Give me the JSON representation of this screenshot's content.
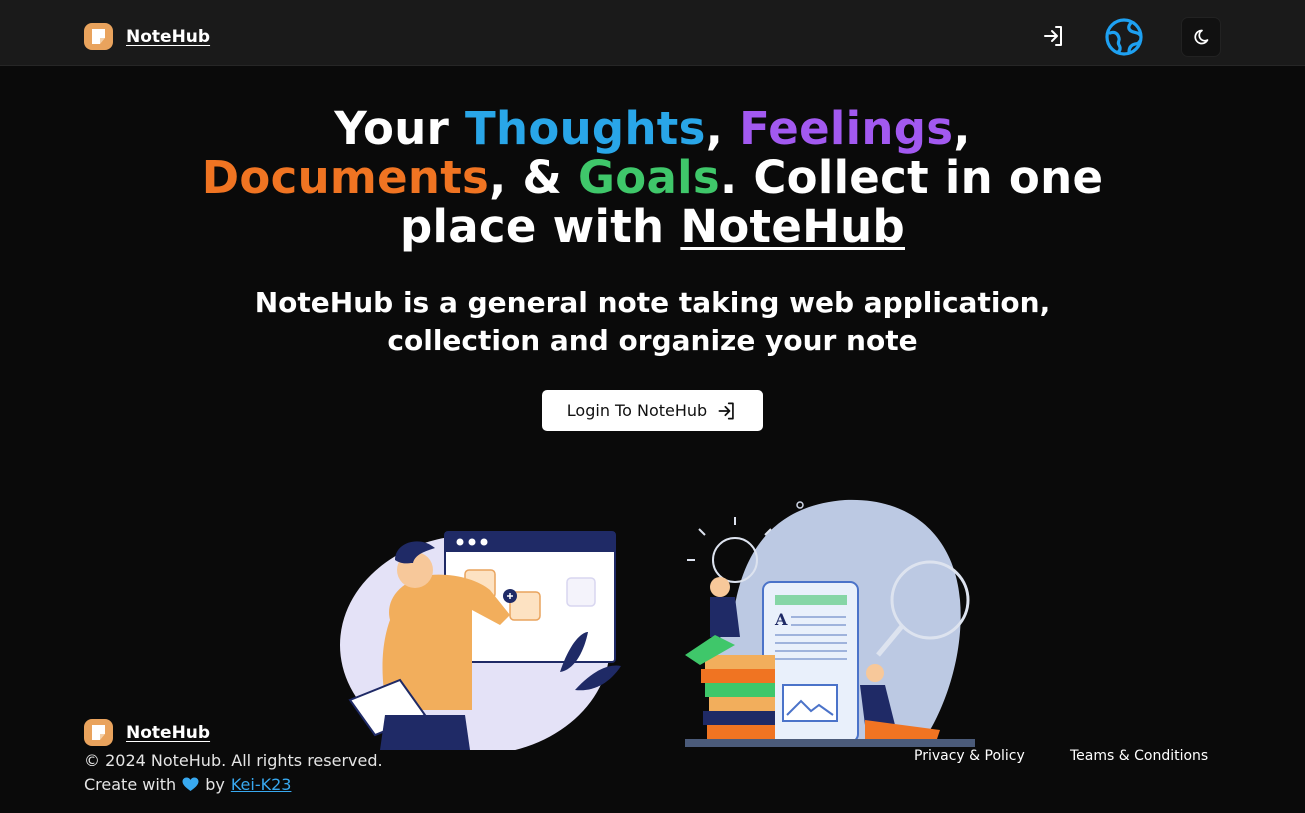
{
  "navbar": {
    "brand_label": "NoteHub",
    "icons": {
      "login": "login-arrow-icon",
      "globe": "globe-icon",
      "theme": "moon-icon"
    }
  },
  "hero": {
    "title_parts": [
      "Your ",
      "Thoughts",
      ", ",
      "Feelings",
      ",",
      "Documents",
      ", & ",
      "Goals",
      ". Collect in one place with ",
      "NoteHub"
    ],
    "subtitle": "NoteHub is a general note taking web application, collection and organize your note",
    "cta_label": "Login To NoteHub"
  },
  "footer": {
    "brand_label": "NoteHub",
    "copyright": "© 2024 NoteHub. All rights reserved.",
    "credit_prefix": "Create with",
    "credit_by": "by",
    "credit_author": "Kei-K23",
    "links": [
      "Privacy & Policy",
      "Teams & Conditions"
    ]
  },
  "colors": {
    "thoughts": "#29a6e8",
    "feelings": "#a259f0",
    "documents": "#f07422",
    "goals": "#3fc76a",
    "accent_blue": "#38a9f0",
    "logo": "#e9a35d"
  }
}
